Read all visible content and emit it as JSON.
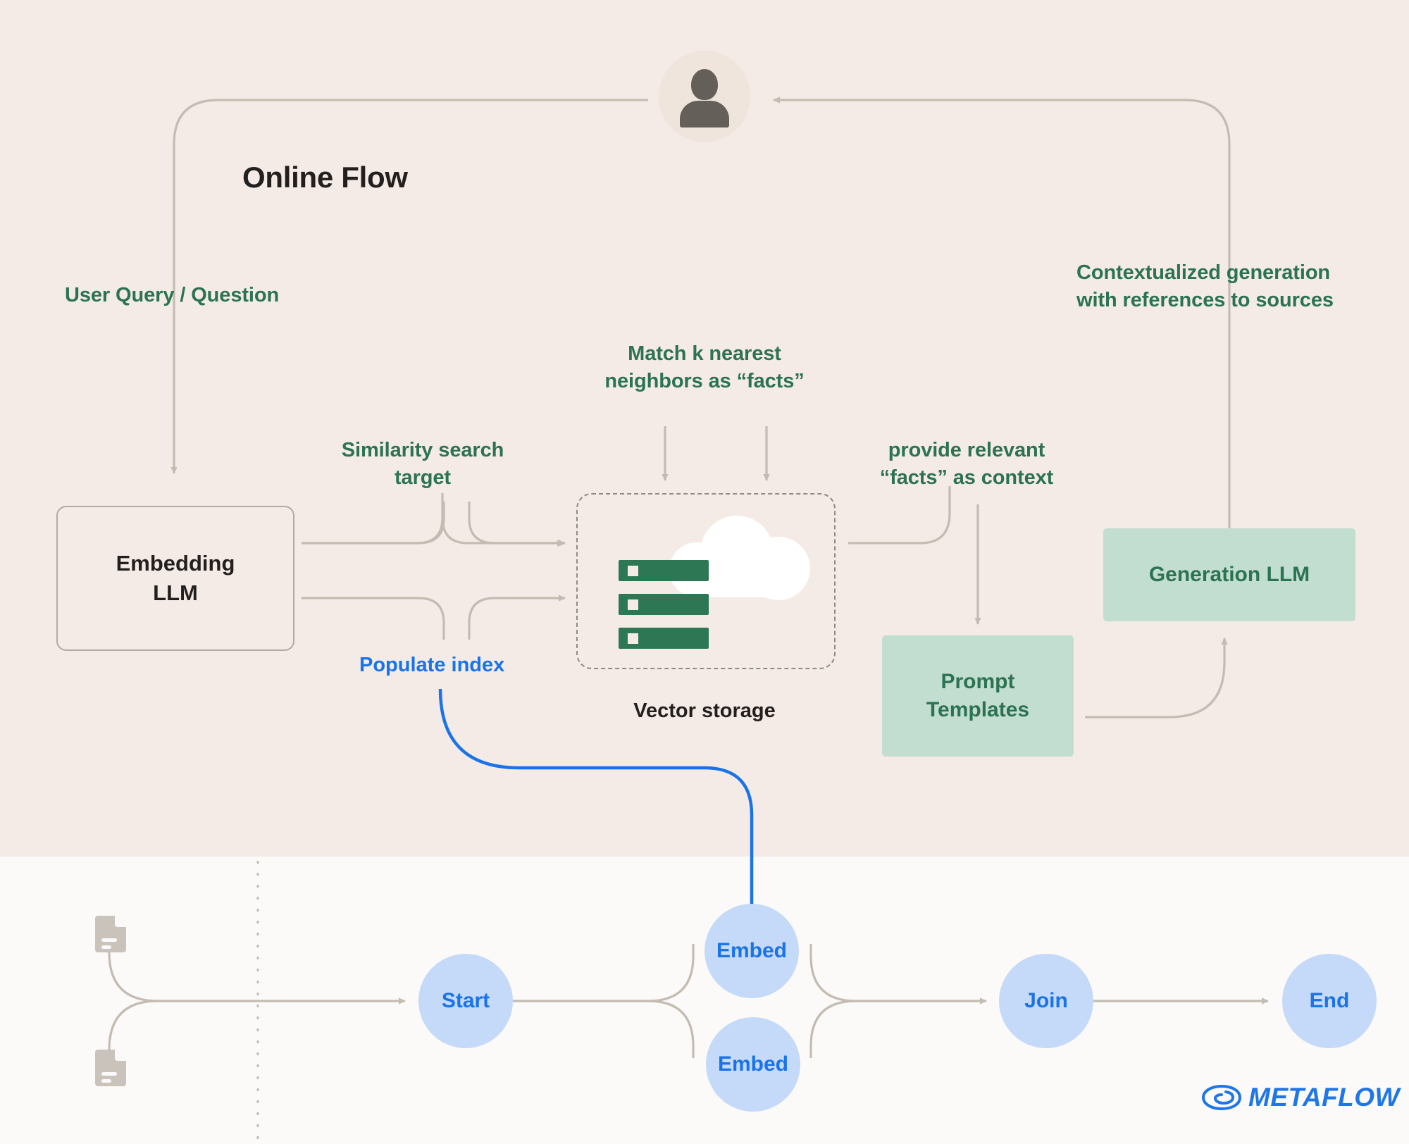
{
  "colors": {
    "band_top_bg": "#f4ebe6",
    "band_bottom_bg": "#fbfaf8",
    "green_text": "#2c7352",
    "green_box_bg": "#c2ded1",
    "blue_accent": "#1a73e8",
    "node_bg": "#c5daf8",
    "wire": "#c4bcb3",
    "server_green": "#2e7755",
    "avatar_bg": "#efe5dd",
    "doc_icon": "#c9c3bb"
  },
  "online_flow": {
    "title": "Online Flow",
    "user_avatar_name": "user-avatar",
    "labels": {
      "user_query": "User Query / Question",
      "similarity_search": "Similarity search\ntarget",
      "populate_index": "Populate index",
      "match_knn": "Match k nearest\nneighbors as “facts”",
      "provide_facts": "provide relevant\n“facts” as context",
      "contextualized": "Contextualized generation\nwith references to sources"
    },
    "nodes": {
      "embedding_llm": "Embedding\nLLM",
      "vector_storage_caption": "Vector storage",
      "prompt_templates": "Prompt\nTemplates",
      "generation_llm": "Generation LLM"
    }
  },
  "offline_flow": {
    "steps": [
      {
        "id": "start",
        "label": "Start"
      },
      {
        "id": "embed-1",
        "label": "Embed"
      },
      {
        "id": "embed-2",
        "label": "Embed"
      },
      {
        "id": "join",
        "label": "Join"
      },
      {
        "id": "end",
        "label": "End"
      }
    ],
    "documents": [
      {
        "id": "doc-1"
      },
      {
        "id": "doc-2"
      }
    ]
  },
  "branding": {
    "wordmark": "METAFLOW"
  }
}
